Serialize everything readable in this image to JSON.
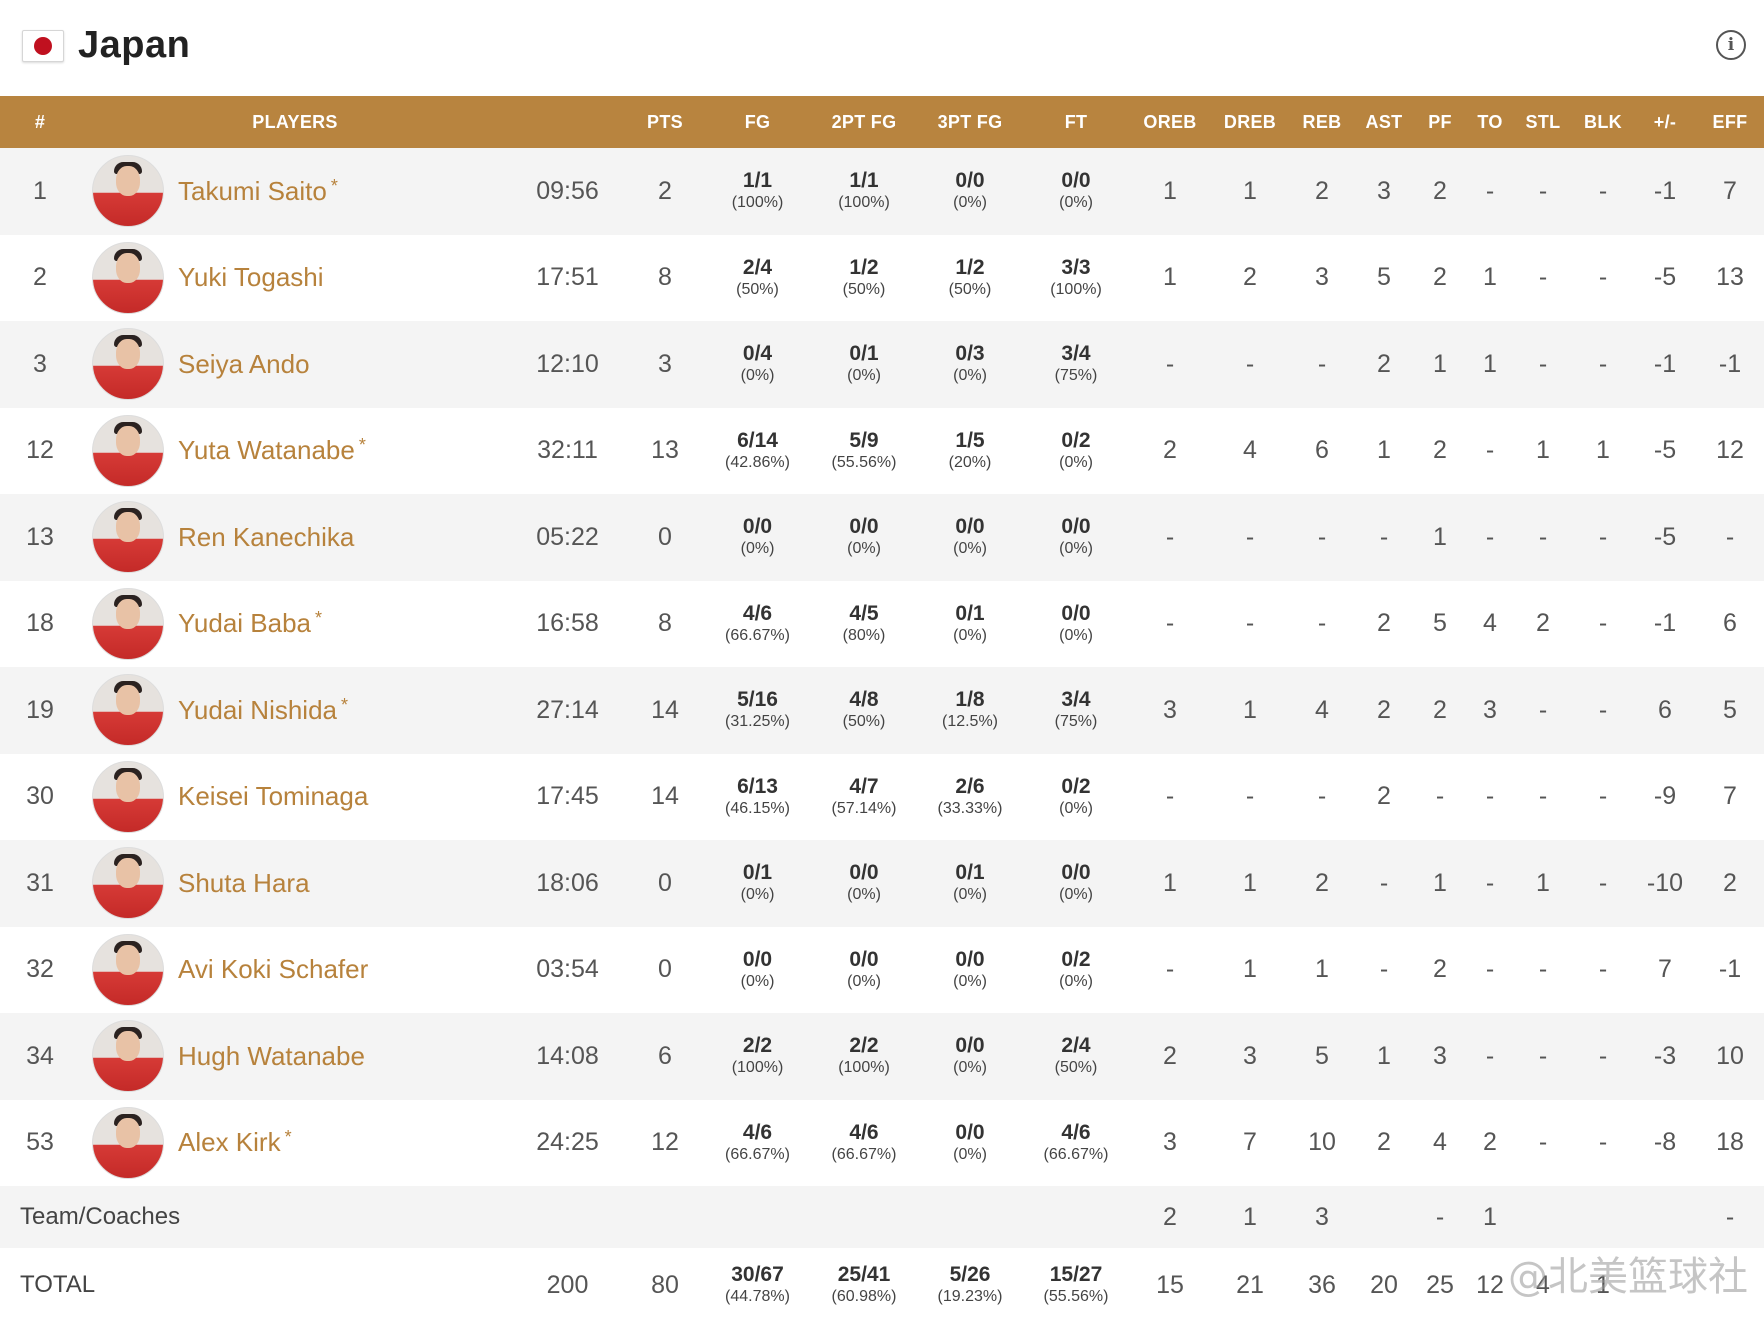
{
  "team": {
    "name": "Japan",
    "flag_icon": "japan-flag-icon",
    "info_icon": "info-icon"
  },
  "columns": [
    "#",
    "PLAYERS",
    "PTS",
    "FG",
    "2PT FG",
    "3PT FG",
    "FT",
    "OREB",
    "DREB",
    "REB",
    "AST",
    "PF",
    "TO",
    "STL",
    "BLK",
    "+/-",
    "EFF"
  ],
  "players": [
    {
      "no": "1",
      "name": "Takumi Saito",
      "starter": "*",
      "min": "09:56",
      "pts": "2",
      "fg": "1/1",
      "fg_pct": "(100%)",
      "fg2": "1/1",
      "fg2_pct": "(100%)",
      "fg3": "0/0",
      "fg3_pct": "(0%)",
      "ft": "0/0",
      "ft_pct": "(0%)",
      "oreb": "1",
      "dreb": "1",
      "reb": "2",
      "ast": "3",
      "pf": "2",
      "to": "-",
      "stl": "-",
      "blk": "-",
      "pm": "-1",
      "eff": "7"
    },
    {
      "no": "2",
      "name": "Yuki Togashi",
      "starter": "",
      "min": "17:51",
      "pts": "8",
      "fg": "2/4",
      "fg_pct": "(50%)",
      "fg2": "1/2",
      "fg2_pct": "(50%)",
      "fg3": "1/2",
      "fg3_pct": "(50%)",
      "ft": "3/3",
      "ft_pct": "(100%)",
      "oreb": "1",
      "dreb": "2",
      "reb": "3",
      "ast": "5",
      "pf": "2",
      "to": "1",
      "stl": "-",
      "blk": "-",
      "pm": "-5",
      "eff": "13"
    },
    {
      "no": "3",
      "name": "Seiya Ando",
      "starter": "",
      "min": "12:10",
      "pts": "3",
      "fg": "0/4",
      "fg_pct": "(0%)",
      "fg2": "0/1",
      "fg2_pct": "(0%)",
      "fg3": "0/3",
      "fg3_pct": "(0%)",
      "ft": "3/4",
      "ft_pct": "(75%)",
      "oreb": "-",
      "dreb": "-",
      "reb": "-",
      "ast": "2",
      "pf": "1",
      "to": "1",
      "stl": "-",
      "blk": "-",
      "pm": "-1",
      "eff": "-1"
    },
    {
      "no": "12",
      "name": "Yuta Watanabe",
      "starter": "*",
      "min": "32:11",
      "pts": "13",
      "fg": "6/14",
      "fg_pct": "(42.86%)",
      "fg2": "5/9",
      "fg2_pct": "(55.56%)",
      "fg3": "1/5",
      "fg3_pct": "(20%)",
      "ft": "0/2",
      "ft_pct": "(0%)",
      "oreb": "2",
      "dreb": "4",
      "reb": "6",
      "ast": "1",
      "pf": "2",
      "to": "-",
      "stl": "1",
      "blk": "1",
      "pm": "-5",
      "eff": "12"
    },
    {
      "no": "13",
      "name": "Ren Kanechika",
      "starter": "",
      "min": "05:22",
      "pts": "0",
      "fg": "0/0",
      "fg_pct": "(0%)",
      "fg2": "0/0",
      "fg2_pct": "(0%)",
      "fg3": "0/0",
      "fg3_pct": "(0%)",
      "ft": "0/0",
      "ft_pct": "(0%)",
      "oreb": "-",
      "dreb": "-",
      "reb": "-",
      "ast": "-",
      "pf": "1",
      "to": "-",
      "stl": "-",
      "blk": "-",
      "pm": "-5",
      "eff": "-"
    },
    {
      "no": "18",
      "name": "Yudai Baba",
      "starter": "*",
      "min": "16:58",
      "pts": "8",
      "fg": "4/6",
      "fg_pct": "(66.67%)",
      "fg2": "4/5",
      "fg2_pct": "(80%)",
      "fg3": "0/1",
      "fg3_pct": "(0%)",
      "ft": "0/0",
      "ft_pct": "(0%)",
      "oreb": "-",
      "dreb": "-",
      "reb": "-",
      "ast": "2",
      "pf": "5",
      "to": "4",
      "stl": "2",
      "blk": "-",
      "pm": "-1",
      "eff": "6"
    },
    {
      "no": "19",
      "name": "Yudai Nishida",
      "starter": "*",
      "min": "27:14",
      "pts": "14",
      "fg": "5/16",
      "fg_pct": "(31.25%)",
      "fg2": "4/8",
      "fg2_pct": "(50%)",
      "fg3": "1/8",
      "fg3_pct": "(12.5%)",
      "ft": "3/4",
      "ft_pct": "(75%)",
      "oreb": "3",
      "dreb": "1",
      "reb": "4",
      "ast": "2",
      "pf": "2",
      "to": "3",
      "stl": "-",
      "blk": "-",
      "pm": "6",
      "eff": "5"
    },
    {
      "no": "30",
      "name": "Keisei Tominaga",
      "starter": "",
      "min": "17:45",
      "pts": "14",
      "fg": "6/13",
      "fg_pct": "(46.15%)",
      "fg2": "4/7",
      "fg2_pct": "(57.14%)",
      "fg3": "2/6",
      "fg3_pct": "(33.33%)",
      "ft": "0/2",
      "ft_pct": "(0%)",
      "oreb": "-",
      "dreb": "-",
      "reb": "-",
      "ast": "2",
      "pf": "-",
      "to": "-",
      "stl": "-",
      "blk": "-",
      "pm": "-9",
      "eff": "7"
    },
    {
      "no": "31",
      "name": "Shuta Hara",
      "starter": "",
      "min": "18:06",
      "pts": "0",
      "fg": "0/1",
      "fg_pct": "(0%)",
      "fg2": "0/0",
      "fg2_pct": "(0%)",
      "fg3": "0/1",
      "fg3_pct": "(0%)",
      "ft": "0/0",
      "ft_pct": "(0%)",
      "oreb": "1",
      "dreb": "1",
      "reb": "2",
      "ast": "-",
      "pf": "1",
      "to": "-",
      "stl": "1",
      "blk": "-",
      "pm": "-10",
      "eff": "2"
    },
    {
      "no": "32",
      "name": "Avi Koki Schafer",
      "starter": "",
      "min": "03:54",
      "pts": "0",
      "fg": "0/0",
      "fg_pct": "(0%)",
      "fg2": "0/0",
      "fg2_pct": "(0%)",
      "fg3": "0/0",
      "fg3_pct": "(0%)",
      "ft": "0/2",
      "ft_pct": "(0%)",
      "oreb": "-",
      "dreb": "1",
      "reb": "1",
      "ast": "-",
      "pf": "2",
      "to": "-",
      "stl": "-",
      "blk": "-",
      "pm": "7",
      "eff": "-1"
    },
    {
      "no": "34",
      "name": "Hugh Watanabe",
      "starter": "",
      "min": "14:08",
      "pts": "6",
      "fg": "2/2",
      "fg_pct": "(100%)",
      "fg2": "2/2",
      "fg2_pct": "(100%)",
      "fg3": "0/0",
      "fg3_pct": "(0%)",
      "ft": "2/4",
      "ft_pct": "(50%)",
      "oreb": "2",
      "dreb": "3",
      "reb": "5",
      "ast": "1",
      "pf": "3",
      "to": "-",
      "stl": "-",
      "blk": "-",
      "pm": "-3",
      "eff": "10"
    },
    {
      "no": "53",
      "name": "Alex Kirk",
      "starter": "*",
      "min": "24:25",
      "pts": "12",
      "fg": "4/6",
      "fg_pct": "(66.67%)",
      "fg2": "4/6",
      "fg2_pct": "(66.67%)",
      "fg3": "0/0",
      "fg3_pct": "(0%)",
      "ft": "4/6",
      "ft_pct": "(66.67%)",
      "oreb": "3",
      "dreb": "7",
      "reb": "10",
      "ast": "2",
      "pf": "4",
      "to": "2",
      "stl": "-",
      "blk": "-",
      "pm": "-8",
      "eff": "18"
    }
  ],
  "team_row": {
    "label": "Team/Coaches",
    "oreb": "2",
    "dreb": "1",
    "reb": "3",
    "pf": "-",
    "to": "1",
    "eff": "-"
  },
  "total_row": {
    "label": "TOTAL",
    "min": "200",
    "pts": "80",
    "fg": "30/67",
    "fg_pct": "(44.78%)",
    "fg2": "25/41",
    "fg2_pct": "(60.98%)",
    "fg3": "5/26",
    "fg3_pct": "(19.23%)",
    "ft": "15/27",
    "ft_pct": "(55.56%)",
    "oreb": "15",
    "dreb": "21",
    "reb": "36",
    "ast": "20",
    "pf": "25",
    "to": "12",
    "stl": "4",
    "blk": "1"
  },
  "watermark": "@北美篮球社",
  "colors": {
    "accent": "#b8843f",
    "link": "#b7823c",
    "row_alt": "#f4f4f4"
  }
}
